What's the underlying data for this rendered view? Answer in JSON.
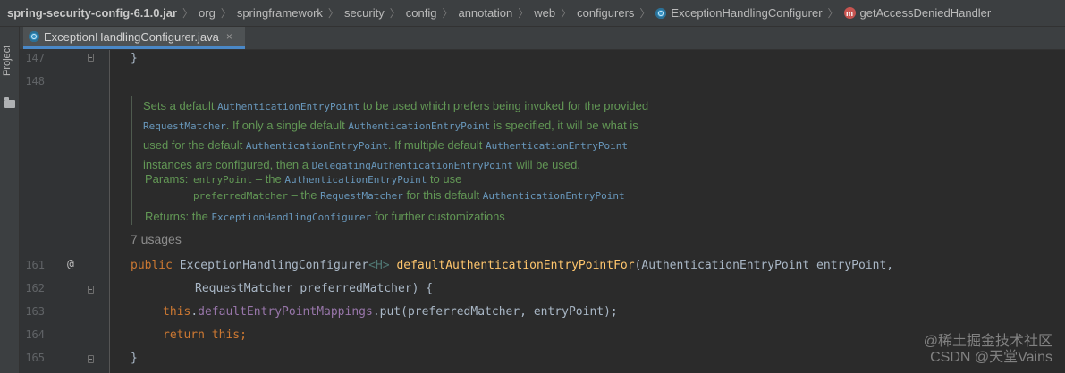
{
  "breadcrumb": {
    "items": [
      "spring-security-config-6.1.0.jar",
      "org",
      "springframework",
      "security",
      "config",
      "annotation",
      "web",
      "configurers",
      "ExceptionHandlingConfigurer",
      "getAccessDeniedHandler"
    ]
  },
  "toolstrip": {
    "project_label": "Project"
  },
  "tab": {
    "title": "ExceptionHandlingConfigurer.java",
    "close": "×"
  },
  "gutter": {
    "line_numbers": [
      "147",
      "148",
      "161",
      "162",
      "163",
      "164",
      "165"
    ],
    "override_mark": "@"
  },
  "code": {
    "line147": "}",
    "line161": {
      "public": "public",
      "ret_type": "ExceptionHandlingConfigurer",
      "generic": "<H>",
      "method": "defaultAuthenticationEntryPointFor",
      "params": "(AuthenticationEntryPoint entryPoint,"
    },
    "line162": "RequestMatcher preferredMatcher) {",
    "line163": {
      "this": "this",
      "dot": ".",
      "field": "defaultEntryPointMappings",
      "rest": ".put(preferredMatcher, entryPoint);"
    },
    "line164": {
      "return": "return",
      "this": "this",
      "semi": ";"
    },
    "line165": "}"
  },
  "javadoc": {
    "l1a": "Sets a default ",
    "l1b": "AuthenticationEntryPoint",
    "l1c": " to be used which prefers being invoked for the provided",
    "l2a": "RequestMatcher",
    "l2b": ". If only a single default ",
    "l2c": "AuthenticationEntryPoint",
    "l2d": " is specified, it will be what is",
    "l3a": "used for the default ",
    "l3b": "AuthenticationEntryPoint",
    "l3c": ". If multiple default ",
    "l3d": "AuthenticationEntryPoint",
    "l4a": "instances are configured, then a ",
    "l4b": "DelegatingAuthenticationEntryPoint",
    "l4c": " will be used.",
    "params_label": "Params:",
    "p1a": "entryPoint",
    "p1b": " – the ",
    "p1c": "AuthenticationEntryPoint",
    "p1d": " to use",
    "p2a": "preferredMatcher",
    "p2b": " – the ",
    "p2c": "RequestMatcher",
    "p2d": " for this default ",
    "p2e": "AuthenticationEntryPoint",
    "returns_label": "Returns:",
    "r1": " the ",
    "r2": "ExceptionHandlingConfigurer",
    "r3": " for further customizations"
  },
  "usages": "7 usages",
  "watermark": {
    "line1": "@稀土掘金技术社区",
    "line2": "CSDN @天堂Vains"
  },
  "colors": {
    "keyword": "#cc7832",
    "method": "#ffc66d",
    "field": "#9876aa",
    "doc_text": "#629755",
    "doc_link": "#6897bb"
  }
}
